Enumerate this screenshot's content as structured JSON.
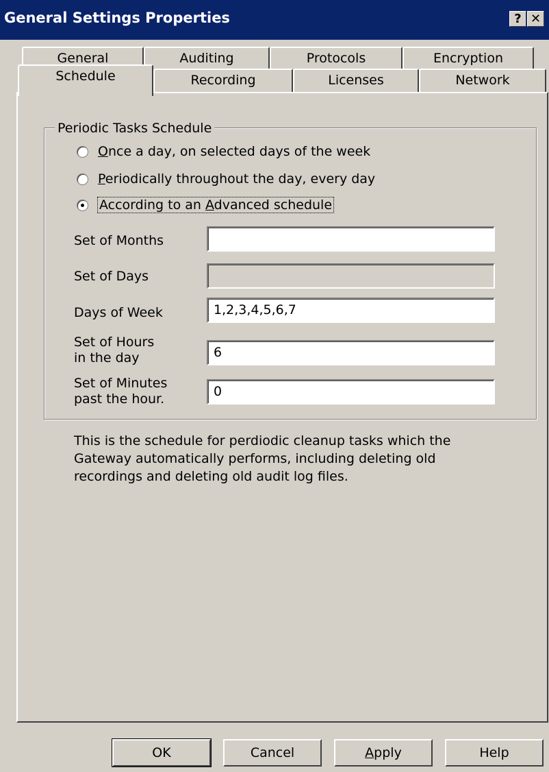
{
  "window": {
    "title": "General Settings Properties",
    "help_glyph": "?",
    "close_glyph": "✕"
  },
  "tabs_back": [
    "General",
    "Auditing",
    "Protocols",
    "Encryption"
  ],
  "tabs_front": [
    "Schedule",
    "Recording",
    "Licenses",
    "Network"
  ],
  "active_tab": "Schedule",
  "group": {
    "title": "Periodic Tasks Schedule",
    "radios": [
      {
        "mnemonic": "O",
        "rest": "nce a day, on selected days of the week",
        "checked": false
      },
      {
        "mnemonic": "P",
        "rest": "eriodically throughout the day, every day",
        "checked": false
      },
      {
        "prefix": "According to an ",
        "mnemonic": "A",
        "rest": "dvanced schedule",
        "checked": true
      }
    ],
    "fields": {
      "months": {
        "label": "Set of Months",
        "value": ""
      },
      "days": {
        "label": "Set of Days",
        "value": "",
        "disabled": true
      },
      "week": {
        "label": "Days of Week",
        "value": "1,2,3,4,5,6,7"
      },
      "hours": {
        "label1": "Set of Hours",
        "label2": "in the day",
        "value": "6"
      },
      "minutes": {
        "label1": "Set of Minutes",
        "label2": "past the hour.",
        "value": "0"
      }
    }
  },
  "description": {
    "line1": "This is the schedule for perdiodic cleanup tasks which the",
    "line2": "Gateway automatically performs, including deleting old",
    "line3": "recordings and deleting old audit log files."
  },
  "buttons": {
    "ok": "OK",
    "cancel": "Cancel",
    "apply_mnemonic": "A",
    "apply_rest": "pply",
    "help": "Help"
  }
}
